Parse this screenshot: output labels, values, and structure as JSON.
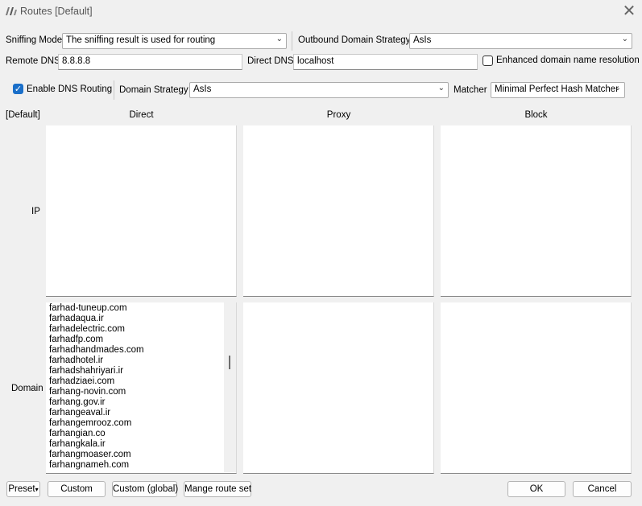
{
  "window": {
    "title": "Routes [Default]"
  },
  "sniffing": {
    "label": "Sniffing Mode",
    "value": "The sniffing result is used for routing"
  },
  "outbound": {
    "label": "Outbound Domain Strategy",
    "value": "AsIs"
  },
  "remote_dns": {
    "label": "Remote DNS",
    "value": "8.8.8.8"
  },
  "direct_dns": {
    "label": "Direct DNS",
    "value": "localhost"
  },
  "enhanced": {
    "label": "Enhanced domain name resolution",
    "checked": false
  },
  "dns_routing": {
    "label": "Enable DNS Routing",
    "checked": true
  },
  "domain_strategy": {
    "label": "Domain Strategy",
    "value": "AsIs"
  },
  "matcher": {
    "label": "Matcher",
    "value": "Minimal Perfect Hash Matcher"
  },
  "grid": {
    "corner": "[Default]",
    "columns": [
      "Direct",
      "Proxy",
      "Block"
    ],
    "rows": [
      "IP",
      "Domain"
    ]
  },
  "direct_domains": [
    "farhad-tuneup.com",
    "farhadaqua.ir",
    "farhadelectric.com",
    "farhadfp.com",
    "farhadhandmades.com",
    "farhadhotel.ir",
    "farhadshahriyari.ir",
    "farhadziaei.com",
    "farhang-novin.com",
    "farhang.gov.ir",
    "farhangeaval.ir",
    "farhangemrooz.com",
    "farhangian.co",
    "farhangkala.ir",
    "farhangmoaser.com",
    "farhangnameh.com"
  ],
  "buttons": {
    "preset": "Preset",
    "custom": "Custom",
    "custom_global": "Custom (global)",
    "manage": "Mange route set",
    "ok": "OK",
    "cancel": "Cancel"
  },
  "colors": {
    "accent": "#1a6fc9",
    "background": "#f0f0f0"
  }
}
